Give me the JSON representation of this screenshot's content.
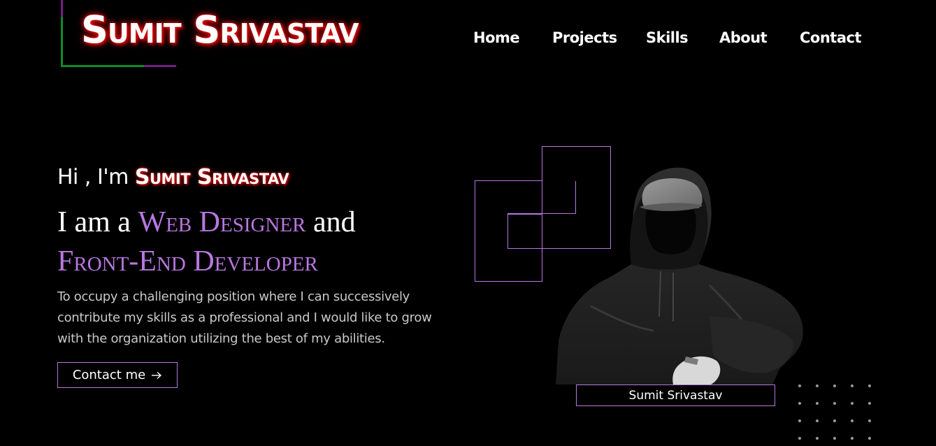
{
  "brand": {
    "logo_text": "Sumit Srivastav"
  },
  "nav": {
    "items": [
      "Home",
      "Projects",
      "Skills",
      "About",
      "Contact"
    ]
  },
  "hero": {
    "greeting_prefix": "Hi , I'm ",
    "greeting_name": "Sumit Srivastav",
    "headline_prefix": "I am a ",
    "headline_role1": "Web Designer",
    "headline_and": " and",
    "headline_role2": "Front-End Developer",
    "description": "To occupy a challenging position where I can successively contribute my skills as a professional and I would like to grow with the organization utilizing the best of my abilities.",
    "cta_label": "Contact me",
    "cta_icon": "arrow-right-icon"
  },
  "portrait": {
    "caption": "Sumit Srivastav"
  },
  "colors": {
    "background": "#000000",
    "accent_purple": "#b877e0",
    "logo_glow_red": "#ff1a1a",
    "frame_green": "#0f8a2a",
    "frame_purple": "#7a1b8a"
  }
}
